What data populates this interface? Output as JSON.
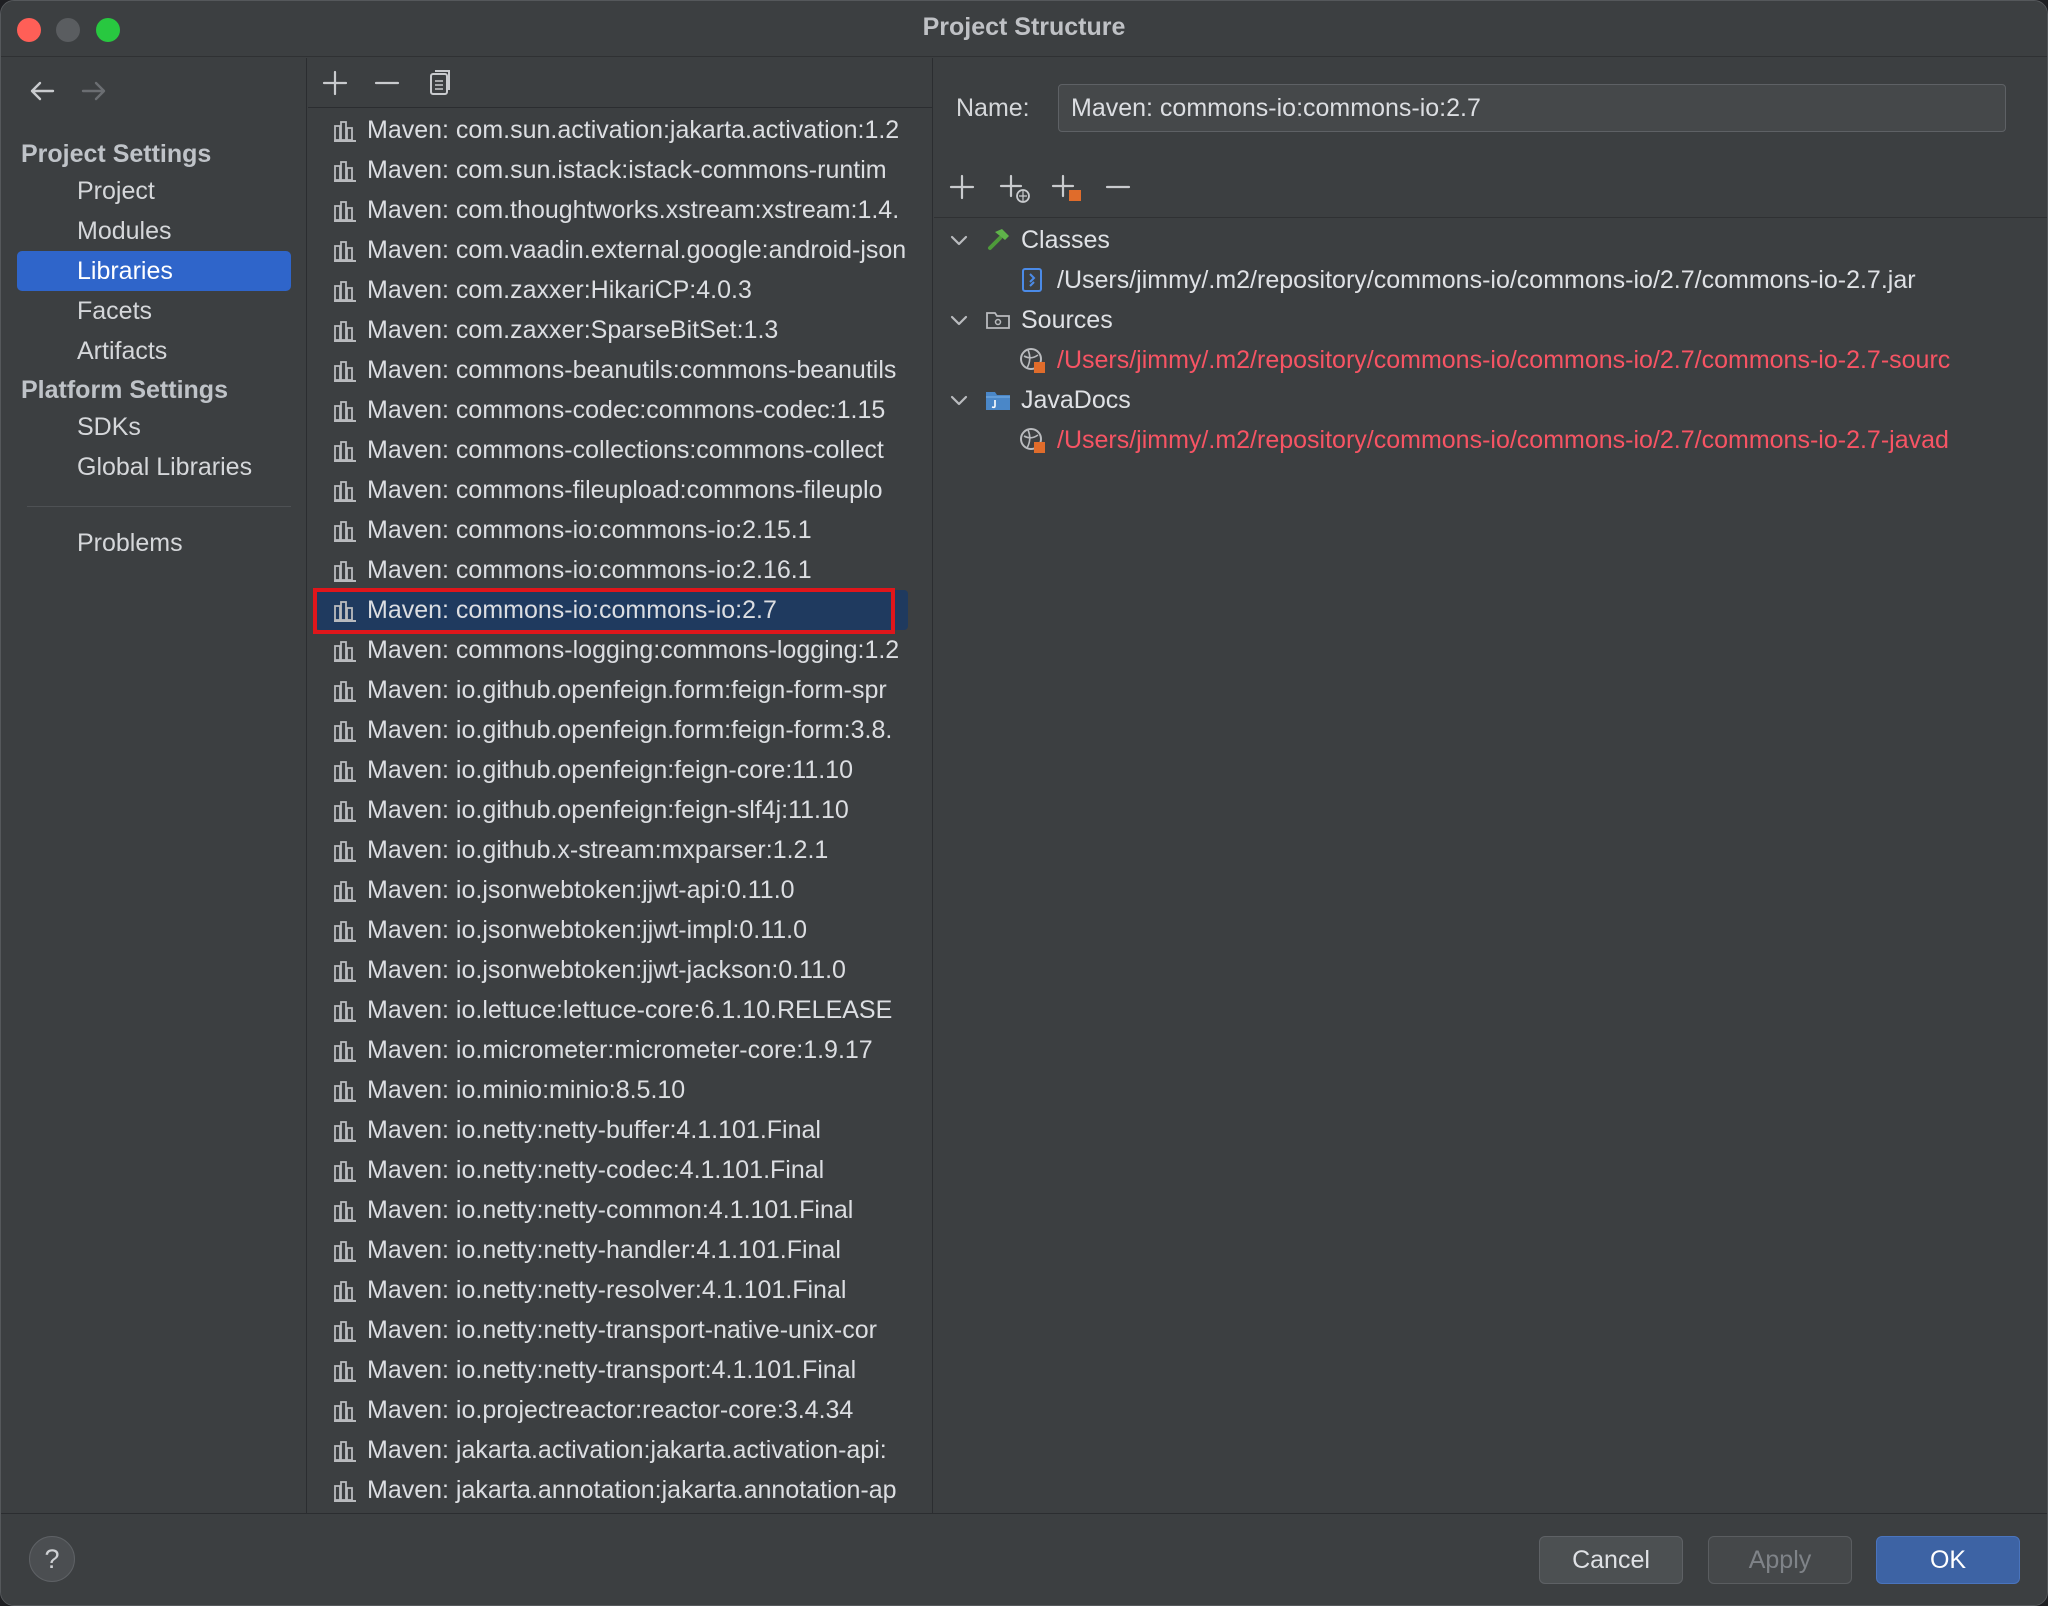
{
  "window": {
    "title": "Project Structure"
  },
  "nav": {
    "project_settings_header": "Project Settings",
    "platform_settings_header": "Platform Settings",
    "items": {
      "project": "Project",
      "modules": "Modules",
      "libraries": "Libraries",
      "facets": "Facets",
      "artifacts": "Artifacts",
      "sdks": "SDKs",
      "global_libraries": "Global Libraries",
      "problems": "Problems"
    },
    "selected": "Libraries"
  },
  "libraries": [
    "Maven: com.sun.activation:jakarta.activation:1.2",
    "Maven: com.sun.istack:istack-commons-runtim",
    "Maven: com.thoughtworks.xstream:xstream:1.4.",
    "Maven: com.vaadin.external.google:android-json",
    "Maven: com.zaxxer:HikariCP:4.0.3",
    "Maven: com.zaxxer:SparseBitSet:1.3",
    "Maven: commons-beanutils:commons-beanutils",
    "Maven: commons-codec:commons-codec:1.15",
    "Maven: commons-collections:commons-collect",
    "Maven: commons-fileupload:commons-fileuplo",
    "Maven: commons-io:commons-io:2.15.1",
    "Maven: commons-io:commons-io:2.16.1",
    "Maven: commons-io:commons-io:2.7",
    "Maven: commons-logging:commons-logging:1.2",
    "Maven: io.github.openfeign.form:feign-form-spr",
    "Maven: io.github.openfeign.form:feign-form:3.8.",
    "Maven: io.github.openfeign:feign-core:11.10",
    "Maven: io.github.openfeign:feign-slf4j:11.10",
    "Maven: io.github.x-stream:mxparser:1.2.1",
    "Maven: io.jsonwebtoken:jjwt-api:0.11.0",
    "Maven: io.jsonwebtoken:jjwt-impl:0.11.0",
    "Maven: io.jsonwebtoken:jjwt-jackson:0.11.0",
    "Maven: io.lettuce:lettuce-core:6.1.10.RELEASE",
    "Maven: io.micrometer:micrometer-core:1.9.17",
    "Maven: io.minio:minio:8.5.10",
    "Maven: io.netty:netty-buffer:4.1.101.Final",
    "Maven: io.netty:netty-codec:4.1.101.Final",
    "Maven: io.netty:netty-common:4.1.101.Final",
    "Maven: io.netty:netty-handler:4.1.101.Final",
    "Maven: io.netty:netty-resolver:4.1.101.Final",
    "Maven: io.netty:netty-transport-native-unix-cor",
    "Maven: io.netty:netty-transport:4.1.101.Final",
    "Maven: io.projectreactor:reactor-core:3.4.34",
    "Maven: jakarta.activation:jakarta.activation-api:",
    "Maven: jakarta.annotation:jakarta.annotation-ap"
  ],
  "selected_library": "Maven: commons-io:commons-io:2.7",
  "detail": {
    "name_label": "Name:",
    "name_value": "Maven: commons-io:commons-io:2.7",
    "tree": {
      "classes_label": "Classes",
      "classes_path": "/Users/jimmy/.m2/repository/commons-io/commons-io/2.7/commons-io-2.7.jar",
      "sources_label": "Sources",
      "sources_path": "/Users/jimmy/.m2/repository/commons-io/commons-io/2.7/commons-io-2.7-sourc",
      "javadocs_label": "JavaDocs",
      "javadocs_path": "/Users/jimmy/.m2/repository/commons-io/commons-io/2.7/commons-io-2.7-javad"
    }
  },
  "buttons": {
    "help": "?",
    "cancel": "Cancel",
    "apply": "Apply",
    "ok": "OK"
  },
  "colors": {
    "accent": "#2f65ca",
    "missing_path": "#f75464",
    "highlight_box": "#e0161b"
  }
}
